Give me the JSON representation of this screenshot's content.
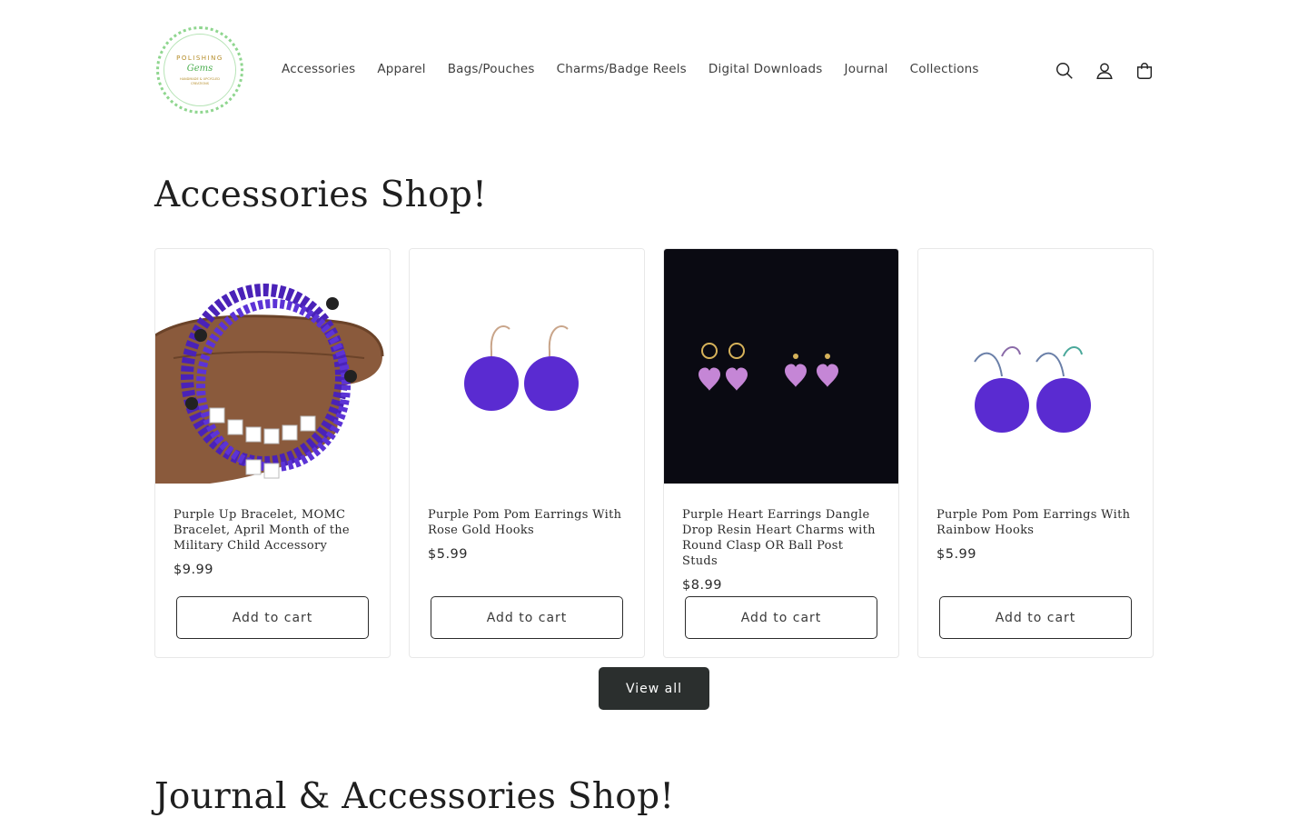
{
  "header": {
    "logo": {
      "line1": "POLISHING",
      "line2": "Gems",
      "line3": "HANDMADE & UPCYCLED CREATIONS"
    },
    "nav": [
      "Accessories",
      "Apparel",
      "Bags/Pouches",
      "Charms/Badge Reels",
      "Digital Downloads",
      "Journal",
      "Collections"
    ],
    "icons": [
      "search-icon",
      "account-icon",
      "cart-icon"
    ]
  },
  "section1": {
    "title": "Accessories Shop!",
    "view_all_label": "View all"
  },
  "products": [
    {
      "title": "Purple Up Bracelet, MOMC Bracelet, April Month of the Military Child Accessory",
      "price": "$9.99",
      "button": "Add to cart",
      "image": "bracelet-photo"
    },
    {
      "title": "Purple Pom Pom Earrings With Rose Gold Hooks",
      "price": "$5.99",
      "button": "Add to cart",
      "image": "pom-pom-earrings-photo"
    },
    {
      "title": "Purple Heart Earrings Dangle Drop Resin Heart Charms with Round Clasp OR Ball Post Studs",
      "price": "$8.99",
      "button": "Add to cart",
      "image": "heart-earrings-photo"
    },
    {
      "title": "Purple Pom Pom Earrings With Rainbow Hooks",
      "price": "$5.99",
      "button": "Add to cart",
      "image": "rainbow-pom-pom-earrings-photo"
    }
  ],
  "section2": {
    "title": "Journal & Accessories Shop!"
  },
  "colors": {
    "accent_purple": "#5a2bd1",
    "button_dark": "#2b2f2e",
    "logo_green": "#8fd68f",
    "logo_gold": "#b58d2a"
  }
}
